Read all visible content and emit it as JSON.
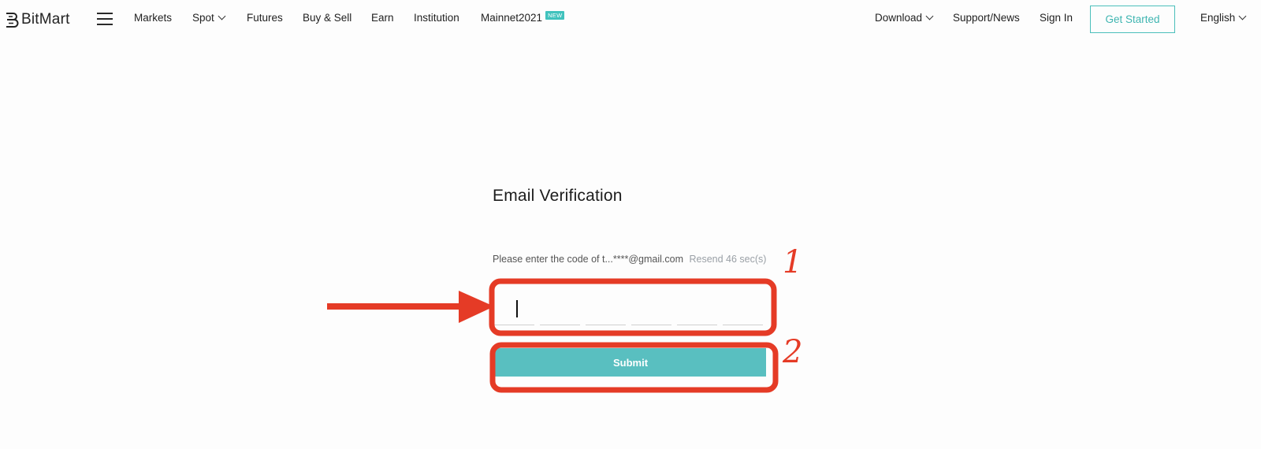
{
  "brand": {
    "name": "BitMart"
  },
  "nav": {
    "markets": "Markets",
    "spot": "Spot",
    "futures": "Futures",
    "buy_sell": "Buy & Sell",
    "earn": "Earn",
    "institution": "Institution",
    "mainnet": "Mainnet2021",
    "new_badge": "NEW",
    "download": "Download",
    "support": "Support/News",
    "sign_in": "Sign In",
    "get_started": "Get Started",
    "language": "English"
  },
  "form": {
    "title": "Email Verification",
    "hint_prefix": "Please enter the code of t...****@gmail.com",
    "resend": "Resend 46 sec(s)",
    "code_digits": [
      "",
      "",
      "",
      "",
      "",
      ""
    ],
    "submit_label": "Submit"
  },
  "annotations": {
    "step1": "1",
    "step2": "2",
    "color": "#e53b26"
  },
  "colors": {
    "accent": "#4bbfbb",
    "submit_bg": "#59bfc0",
    "badge_bg": "#40c2bd"
  }
}
